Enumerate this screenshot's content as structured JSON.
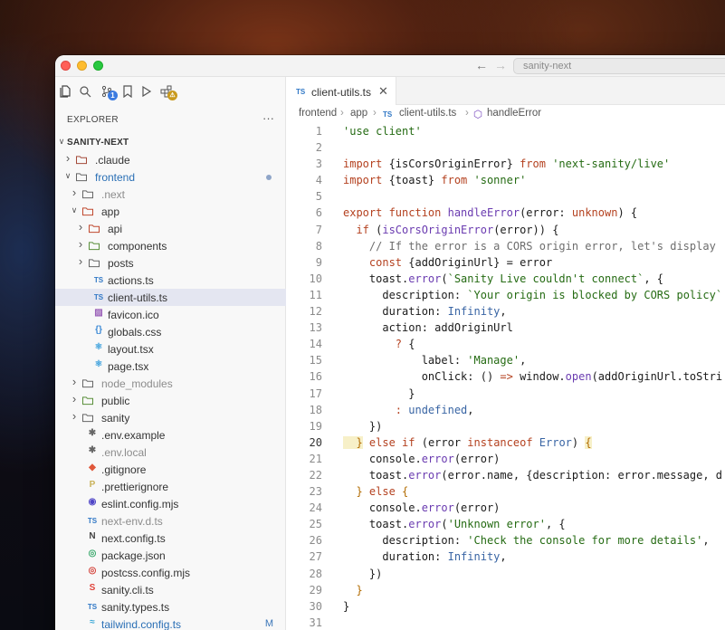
{
  "titlebar": {
    "back_arrow": "←",
    "forward_arrow": "→",
    "command_center": "sanity-next"
  },
  "activity_bar": {
    "badges": [
      {
        "icon": "source-control-icon",
        "count": "1",
        "color": "#3b7be0"
      },
      {
        "icon": "extensions-icon",
        "count": "⚠",
        "color": "#c99a1e"
      }
    ]
  },
  "explorer": {
    "title": "EXPLORER",
    "more": "···",
    "tree": [
      {
        "depth": 0,
        "type": "root",
        "label": "SANITY-NEXT",
        "open": true
      },
      {
        "depth": 1,
        "type": "folder",
        "label": ".claude",
        "open": false,
        "icon_color": "#a44b3a"
      },
      {
        "depth": 1,
        "type": "folder",
        "label": "frontend",
        "open": true,
        "style": "blue",
        "dot": true
      },
      {
        "depth": 2,
        "type": "folder",
        "label": ".next",
        "open": false,
        "style": "dim"
      },
      {
        "depth": 2,
        "type": "folder",
        "label": "app",
        "open": true,
        "icon_color": "#c0492f"
      },
      {
        "depth": 3,
        "type": "folder",
        "label": "api",
        "open": false,
        "icon_color": "#c0492f"
      },
      {
        "depth": 3,
        "type": "folder",
        "label": "components",
        "open": false,
        "icon_color": "#5a8f3b"
      },
      {
        "depth": 3,
        "type": "folder",
        "label": "posts",
        "open": false
      },
      {
        "depth": 3,
        "type": "file",
        "label": "actions.ts",
        "icon": "TS",
        "icon_color": "#3178c6"
      },
      {
        "depth": 3,
        "type": "file",
        "label": "client-utils.ts",
        "icon": "TS",
        "icon_color": "#3178c6",
        "selected": true
      },
      {
        "depth": 3,
        "type": "file",
        "label": "favicon.ico",
        "icon": "▨",
        "icon_color": "#9a60b8"
      },
      {
        "depth": 3,
        "type": "file",
        "label": "globals.css",
        "icon": "{}",
        "icon_color": "#3f8bd6"
      },
      {
        "depth": 3,
        "type": "file",
        "label": "layout.tsx",
        "icon": "⚛",
        "icon_color": "#3ca0dc"
      },
      {
        "depth": 3,
        "type": "file",
        "label": "page.tsx",
        "icon": "⚛",
        "icon_color": "#3ca0dc"
      },
      {
        "depth": 2,
        "type": "folder",
        "label": "node_modules",
        "open": false,
        "style": "dim"
      },
      {
        "depth": 2,
        "type": "folder",
        "label": "public",
        "open": false,
        "icon_color": "#5a8f3b"
      },
      {
        "depth": 2,
        "type": "folder",
        "label": "sanity",
        "open": false
      },
      {
        "depth": 2,
        "type": "file",
        "label": ".env.example",
        "icon": "✱",
        "icon_color": "#666666"
      },
      {
        "depth": 2,
        "type": "file",
        "label": ".env.local",
        "icon": "✱",
        "icon_color": "#666666",
        "style": "dim"
      },
      {
        "depth": 2,
        "type": "file",
        "label": ".gitignore",
        "icon": "◆",
        "icon_color": "#e0573a"
      },
      {
        "depth": 2,
        "type": "file",
        "label": ".prettierignore",
        "icon": "P",
        "icon_color": "#c9b25a"
      },
      {
        "depth": 2,
        "type": "file",
        "label": "eslint.config.mjs",
        "icon": "◉",
        "icon_color": "#5046c7"
      },
      {
        "depth": 2,
        "type": "file",
        "label": "next-env.d.ts",
        "icon": "TS",
        "icon_color": "#3178c6",
        "style": "dim"
      },
      {
        "depth": 2,
        "type": "file",
        "label": "next.config.ts",
        "icon": "N",
        "icon_color": "#444444"
      },
      {
        "depth": 2,
        "type": "file",
        "label": "package.json",
        "icon": "◎",
        "icon_color": "#39a86b"
      },
      {
        "depth": 2,
        "type": "file",
        "label": "postcss.config.mjs",
        "icon": "◎",
        "icon_color": "#d4423a"
      },
      {
        "depth": 2,
        "type": "file",
        "label": "sanity.cli.ts",
        "icon": "S",
        "icon_color": "#e0433a"
      },
      {
        "depth": 2,
        "type": "file",
        "label": "sanity.types.ts",
        "icon": "TS",
        "icon_color": "#3178c6"
      },
      {
        "depth": 2,
        "type": "file",
        "label": "tailwind.config.ts",
        "icon": "≈",
        "icon_color": "#38a7d6",
        "style": "blue",
        "flag": "M"
      }
    ]
  },
  "tab": {
    "icon": "TS",
    "label": "client-utils.ts",
    "close": "✕"
  },
  "breadcrumb": {
    "parts": [
      "frontend",
      "app",
      "client-utils.ts",
      "handleError"
    ],
    "separator": "›",
    "file_icon": "TS",
    "symbol_icon": "⬡"
  },
  "editor": {
    "active_line": 20,
    "lines": [
      {
        "n": "1",
        "tokens": [
          [
            "str",
            "'use client'"
          ]
        ]
      },
      {
        "n": "2",
        "tokens": []
      },
      {
        "n": "3",
        "tokens": [
          [
            "kw",
            "import "
          ],
          [
            "prop",
            "{isCorsOriginError} "
          ],
          [
            "kw",
            "from "
          ],
          [
            "str",
            "'next-sanity/live'"
          ]
        ]
      },
      {
        "n": "4",
        "tokens": [
          [
            "kw",
            "import "
          ],
          [
            "prop",
            "{toast} "
          ],
          [
            "kw",
            "from "
          ],
          [
            "str",
            "'sonner'"
          ]
        ]
      },
      {
        "n": "5",
        "tokens": []
      },
      {
        "n": "6",
        "tokens": [
          [
            "kw",
            "export function "
          ],
          [
            "fn",
            "handleError"
          ],
          [
            "prop",
            "(error: "
          ],
          [
            "kw",
            "unknown"
          ],
          [
            "prop",
            ") {"
          ]
        ]
      },
      {
        "n": "7",
        "tokens": [
          [
            "kw",
            "  if "
          ],
          [
            "prop",
            "("
          ],
          [
            "fn",
            "isCorsOriginError"
          ],
          [
            "prop",
            "(error)) {"
          ]
        ]
      },
      {
        "n": "8",
        "tokens": [
          [
            "cm",
            "    // If the error is a CORS origin error, let's display"
          ]
        ]
      },
      {
        "n": "9",
        "tokens": [
          [
            "kw",
            "    const "
          ],
          [
            "prop",
            "{addOriginUrl} = error"
          ]
        ]
      },
      {
        "n": "10",
        "tokens": [
          [
            "prop",
            "    toast."
          ],
          [
            "fn",
            "error"
          ],
          [
            "prop",
            "("
          ],
          [
            "str",
            "`Sanity Live couldn't connect`"
          ],
          [
            "prop",
            ", {"
          ]
        ]
      },
      {
        "n": "11",
        "tokens": [
          [
            "prop",
            "      description: "
          ],
          [
            "str",
            "`Your origin is blocked by CORS policy`"
          ]
        ]
      },
      {
        "n": "12",
        "tokens": [
          [
            "prop",
            "      duration: "
          ],
          [
            "cls",
            "Infinity"
          ],
          [
            "prop",
            ","
          ]
        ]
      },
      {
        "n": "13",
        "tokens": [
          [
            "prop",
            "      action: addOriginUrl"
          ]
        ]
      },
      {
        "n": "14",
        "tokens": [
          [
            "kw",
            "        ? "
          ],
          [
            "prop",
            "{"
          ]
        ]
      },
      {
        "n": "15",
        "tokens": [
          [
            "prop",
            "            label: "
          ],
          [
            "str",
            "'Manage'"
          ],
          [
            "prop",
            ","
          ]
        ]
      },
      {
        "n": "16",
        "tokens": [
          [
            "prop",
            "            onClick: () "
          ],
          [
            "kw",
            "=> "
          ],
          [
            "prop",
            "window."
          ],
          [
            "fn",
            "open"
          ],
          [
            "prop",
            "(addOriginUrl.toStri"
          ]
        ]
      },
      {
        "n": "17",
        "tokens": [
          [
            "prop",
            "          }"
          ]
        ]
      },
      {
        "n": "18",
        "tokens": [
          [
            "kw",
            "        : "
          ],
          [
            "cls",
            "undefined"
          ],
          [
            "prop",
            ","
          ]
        ]
      },
      {
        "n": "19",
        "tokens": [
          [
            "prop",
            "    })"
          ]
        ]
      },
      {
        "n": "20",
        "tokens": [
          [
            "br1",
            "  }"
          ],
          [
            "kw",
            " else if "
          ],
          [
            "prop",
            "(error "
          ],
          [
            "kw",
            "instanceof "
          ],
          [
            "cls",
            "Error"
          ],
          [
            "prop",
            ") "
          ],
          [
            "br1",
            "{"
          ]
        ]
      },
      {
        "n": "21",
        "tokens": [
          [
            "prop",
            "    console."
          ],
          [
            "fn",
            "error"
          ],
          [
            "prop",
            "(error)"
          ]
        ]
      },
      {
        "n": "22",
        "tokens": [
          [
            "prop",
            "    toast."
          ],
          [
            "fn",
            "error"
          ],
          [
            "prop",
            "(error.name, {description: error.message, d"
          ]
        ]
      },
      {
        "n": "23",
        "tokens": [
          [
            "br1",
            "  }"
          ],
          [
            "kw",
            " else "
          ],
          [
            "br1",
            "{"
          ]
        ]
      },
      {
        "n": "24",
        "tokens": [
          [
            "prop",
            "    console."
          ],
          [
            "fn",
            "error"
          ],
          [
            "prop",
            "(error)"
          ]
        ]
      },
      {
        "n": "25",
        "tokens": [
          [
            "prop",
            "    toast."
          ],
          [
            "fn",
            "error"
          ],
          [
            "prop",
            "("
          ],
          [
            "str",
            "'Unknown error'"
          ],
          [
            "prop",
            ", {"
          ]
        ]
      },
      {
        "n": "26",
        "tokens": [
          [
            "prop",
            "      description: "
          ],
          [
            "str",
            "'Check the console for more details'"
          ],
          [
            "prop",
            ","
          ]
        ]
      },
      {
        "n": "27",
        "tokens": [
          [
            "prop",
            "      duration: "
          ],
          [
            "cls",
            "Infinity"
          ],
          [
            "prop",
            ","
          ]
        ]
      },
      {
        "n": "28",
        "tokens": [
          [
            "prop",
            "    })"
          ]
        ]
      },
      {
        "n": "29",
        "tokens": [
          [
            "br1",
            "  }"
          ]
        ]
      },
      {
        "n": "30",
        "tokens": [
          [
            "prop",
            "}"
          ]
        ]
      },
      {
        "n": "31",
        "tokens": []
      }
    ]
  }
}
